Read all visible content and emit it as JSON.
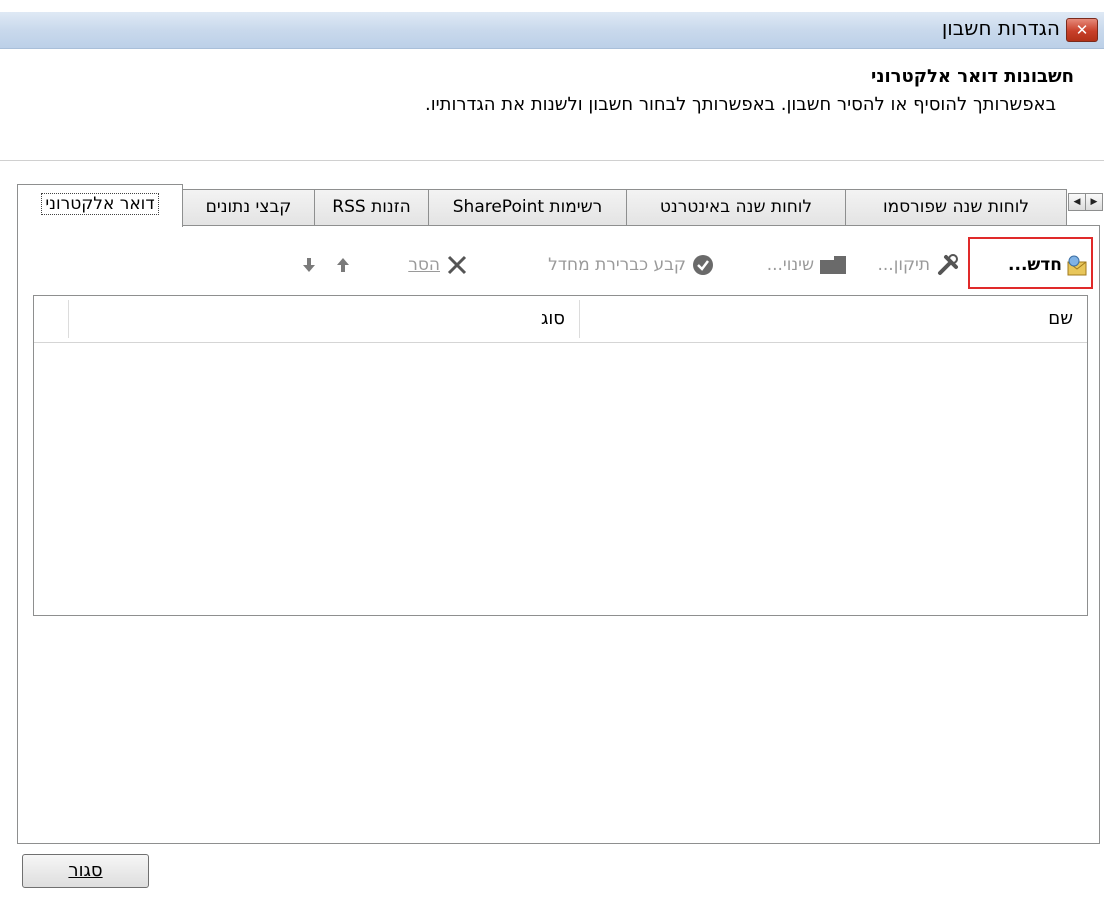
{
  "window": {
    "title": "הגדרות חשבון",
    "close_glyph": "✕"
  },
  "header": {
    "title": "חשבונות דואר אלקטרוני",
    "description": "באפשרותך להוסיף או להסיר חשבון. באפשרותך לבחור חשבון ולשנות את הגדרותיו."
  },
  "tabs": [
    {
      "label": "דואר אלקטרוני",
      "active": true
    },
    {
      "label": "קבצי נתונים"
    },
    {
      "label": "הזנות RSS"
    },
    {
      "label": "רשימות SharePoint"
    },
    {
      "label": "לוחות שנה באינטרנט"
    },
    {
      "label": "לוחות שנה שפורסמו"
    }
  ],
  "toolbar": {
    "new": {
      "label": "חדש...",
      "icon": "new-account-icon"
    },
    "repair": {
      "label": "תיקון...",
      "icon": "tools-icon"
    },
    "change": {
      "label": "שינוי...",
      "icon": "change-icon"
    },
    "set_default": {
      "label": "קבע כברירת מחדל",
      "icon": "checkmark-icon"
    },
    "remove": {
      "label": "הסר",
      "icon": "remove-x-icon"
    },
    "move_up_icon": "arrow-up-icon",
    "move_down_icon": "arrow-down-icon"
  },
  "list": {
    "columns": {
      "name": "שם",
      "type": "סוג"
    },
    "rows": []
  },
  "footer": {
    "close_label": "סגור"
  },
  "colors": {
    "highlight": "#e02a2a",
    "titlebar": "#c9d9ec",
    "close_button": "#c8402a"
  }
}
